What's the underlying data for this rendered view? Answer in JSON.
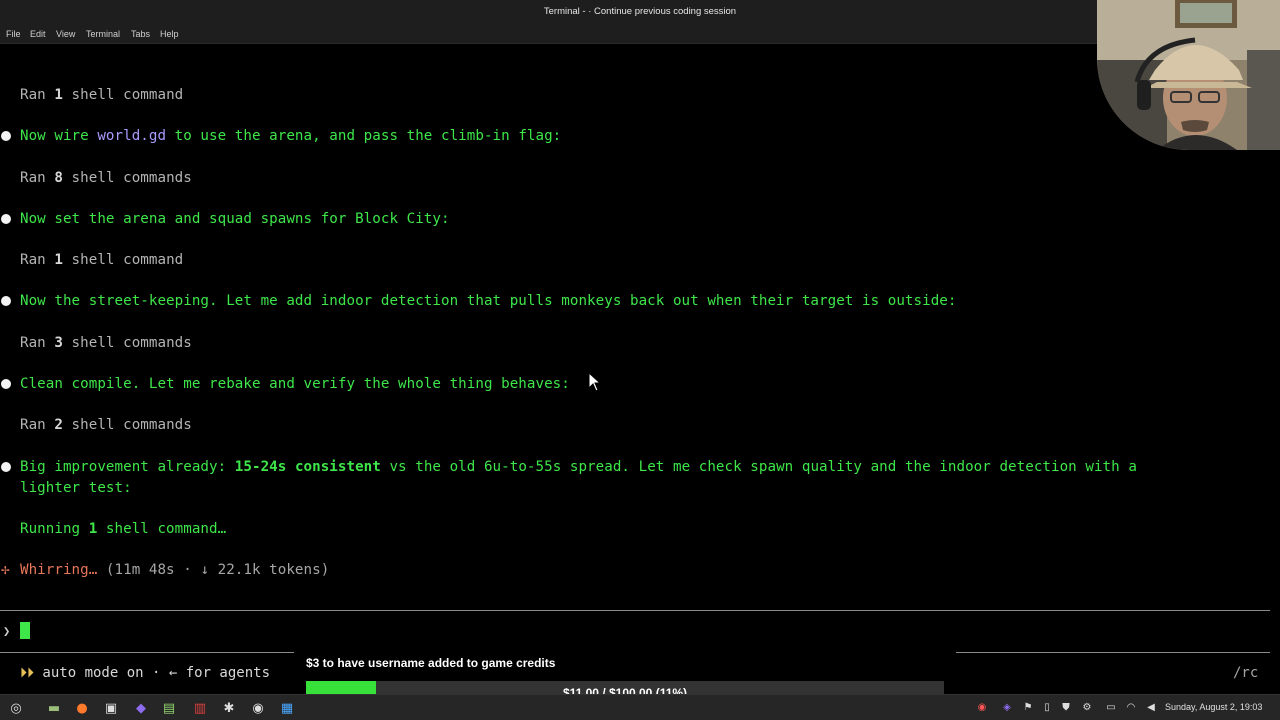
{
  "window": {
    "title": "Terminal - · Continue previous coding session"
  },
  "menu": [
    "File",
    "Edit",
    "View",
    "Terminal",
    "Tabs",
    "Help"
  ],
  "transcript": {
    "ran1": {
      "prefix": "Ran ",
      "count": "1",
      "suffix": " shell command"
    },
    "msg1": {
      "a": "Now wire ",
      "file": "world.gd",
      "b": " to use the arena, and pass the climb-in flag:"
    },
    "ran2": {
      "prefix": "Ran ",
      "count": "8",
      "suffix": " shell commands"
    },
    "msg2": "Now set the arena and squad spawns for Block City:",
    "ran3": {
      "prefix": "Ran ",
      "count": "1",
      "suffix": " shell command"
    },
    "msg3": "Now the street-keeping. Let me add indoor detection that pulls monkeys back out when their target is outside:",
    "ran4": {
      "prefix": "Ran ",
      "count": "3",
      "suffix": " shell commands"
    },
    "msg4": "Clean compile. Let me rebake and verify the whole thing behaves:",
    "ran5": {
      "prefix": "Ran ",
      "count": "2",
      "suffix": " shell commands"
    },
    "msg5": {
      "a": "Big improvement already: ",
      "bold": "15-24s consistent",
      "b": " vs the old 6u-to-55s spread. Let me check spawn quality and the indoor detection with a",
      "c": "lighter test:"
    },
    "running": {
      "prefix": "Running ",
      "count": "1",
      "suffix": " shell command…"
    },
    "status": {
      "icon": "✢",
      "word": "Whirring…",
      "meta": " (11m 48s · ↓ 22.1k tokens)"
    }
  },
  "prompt": {
    "symbol": "❯",
    "value": ""
  },
  "footer": {
    "arrows": "⏵⏵",
    "text": " auto mode on · ← for agents",
    "right": "/rc"
  },
  "overlay": {
    "title": "$3 to have username added to game credits",
    "progress_text": "$11.00 / $100.00 (11%)",
    "progress_fraction": 0.11,
    "fill_color": "#38e13a"
  },
  "taskbar": {
    "clock": "Sunday, August  2, 19:03",
    "icons": [
      "menu-icon",
      "files-icon",
      "firefox-icon",
      "terminal-icon",
      "obsidian-icon",
      "app-icon",
      "pdf-icon",
      "settings-icon",
      "chrome-icon",
      "app2-icon"
    ]
  }
}
